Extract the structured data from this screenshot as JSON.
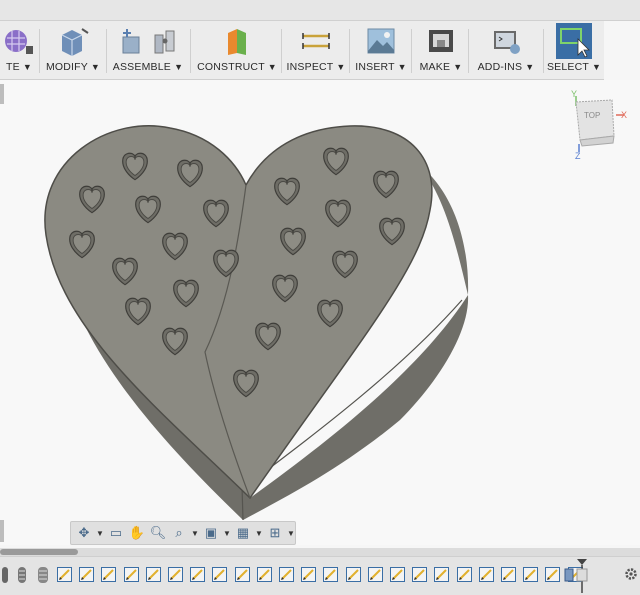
{
  "toolbar": {
    "groups": [
      {
        "id": "create",
        "label": "TE"
      },
      {
        "id": "modify",
        "label": "MODIFY"
      },
      {
        "id": "assemble",
        "label": "ASSEMBLE"
      },
      {
        "id": "construct",
        "label": "CONSTRUCT"
      },
      {
        "id": "inspect",
        "label": "INSPECT"
      },
      {
        "id": "insert",
        "label": "INSERT"
      },
      {
        "id": "make",
        "label": "MAKE"
      },
      {
        "id": "addins",
        "label": "ADD-INS"
      },
      {
        "id": "select",
        "label": "SELECT"
      }
    ]
  },
  "viewcube": {
    "face": "TOP",
    "axis_x": "X",
    "axis_y": "Y",
    "axis_z": "Z"
  },
  "colors": {
    "model_fill": "#8b8a82",
    "model_side": "#777670",
    "toolbar_bg": "#ececec",
    "select_blue": "#3a6ea5"
  },
  "navbar": {
    "icons": [
      "orbit-icon",
      "look-at-icon",
      "pan-icon",
      "zoom-window-icon",
      "zoom-icon",
      "display-settings-icon",
      "grid-settings-icon",
      "viewports-icon"
    ]
  },
  "timeline": {
    "feature_count": 24
  }
}
